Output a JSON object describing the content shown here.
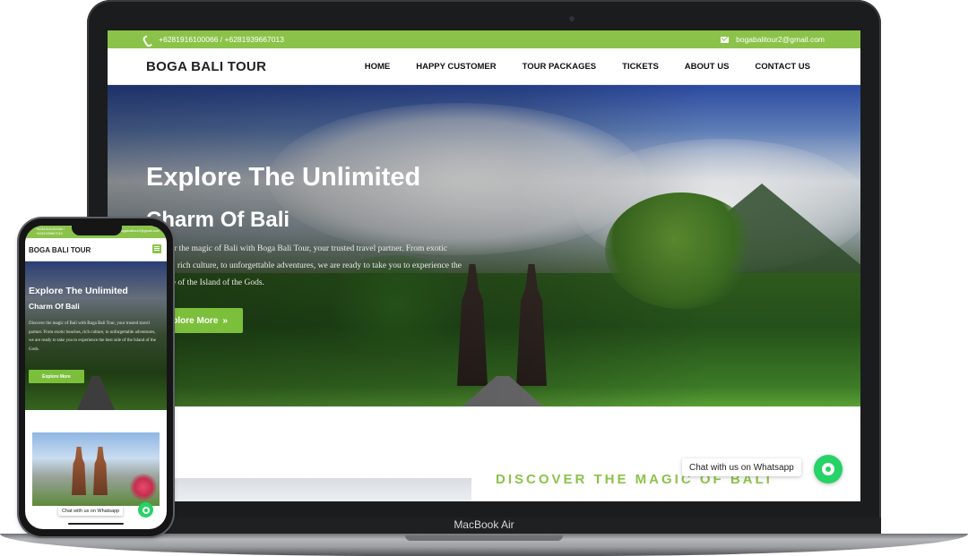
{
  "laptop": {
    "base_label": "MacBook Air"
  },
  "site": {
    "topbar": {
      "phone": "+6281916100066 / +6281939667013",
      "email": "bogabalitour2@gmail.com"
    },
    "brand": "BOGA BALI TOUR",
    "nav": [
      "HOME",
      "HAPPY CUSTOMER",
      "TOUR PACKAGES",
      "TICKETS",
      "ABOUT US",
      "CONTACT US"
    ],
    "hero": {
      "title_line1": "Explore The Unlimited",
      "title_line2": "Charm Of Bali",
      "description": "Discover the magic of Bali with Boga Bali Tour, your trusted travel partner. From exotic beaches, rich culture, to unforgettable adventures, we are ready to take you to experience the best side of the Island of the Gods.",
      "button": "Explore More"
    },
    "section_title": "DISCOVER THE MAGIC OF BALI",
    "chat": "Chat with us on Whatsapp"
  },
  "phone": {
    "topbar_phone": "+6281916100066 / +6281939667013",
    "topbar_email": "bogabalitour2@gmail.com",
    "brand": "BOGA BALI TOUR",
    "hero_title_line1": "Explore The Unlimited",
    "hero_title_line2": "Charm Of Bali",
    "hero_description": "Discover the magic of Bali with Boga Bali Tour, your trusted travel partner. From exotic beaches, rich culture, to unforgettable adventures, we are ready to take you to experience the best side of the Island of the Gods.",
    "hero_button": "Explore More",
    "chat": "Chat with us on Whatsapp"
  },
  "colors": {
    "accent": "#8bc34a",
    "button": "#7cbf3b",
    "whatsapp": "#25d366"
  }
}
